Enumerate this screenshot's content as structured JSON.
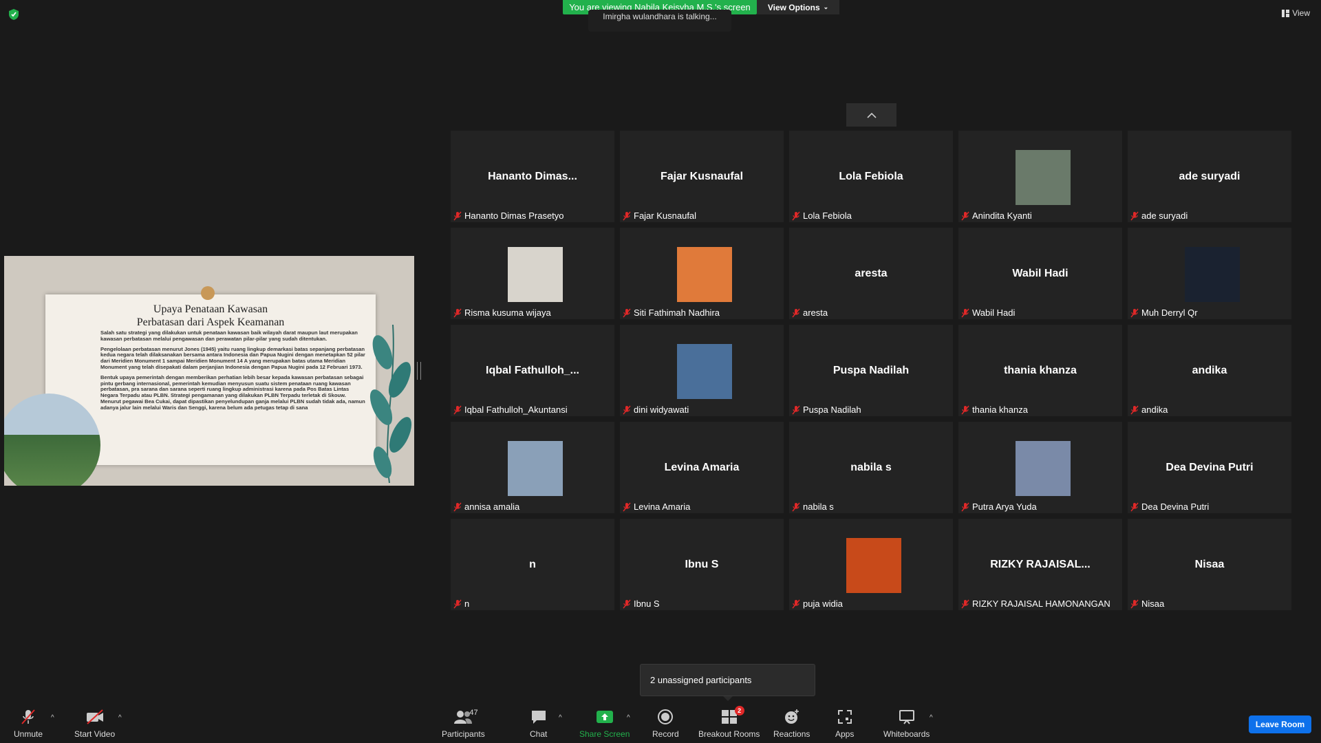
{
  "top": {
    "banner": "You are viewing Nabila Keisyha M.S.'s screen",
    "view_options": "View Options",
    "talking": "Imirgha wulandhara is talking...",
    "view": "View"
  },
  "slide": {
    "title_line1": "Upaya Penataan Kawasan",
    "title_line2": "Perbatasan dari Aspek Keamanan",
    "para1": "Salah satu strategi yang dilakukan untuk penataan kawasan baik wilayah darat maupun laut merupakan kawasan perbatasan melalui pengawasan dan perawatan pilar-pilar yang sudah ditentukan.",
    "para2": "Pengelolaan perbatasan menurut Jones (1945) yaitu ruang lingkup demarkasi batas sepanjang perbatasan kedua negara telah dilaksanakan bersama antara Indonesia dan Papua Nugini dengan menetapkan 52 pilar dari Meridien Monument 1 sampai Meridien Monument 14 A yang merupakan batas utama Meridian Monument yang telah disepakati dalam perjanjian Indonesia dengan Papua Nugini pada 12 Februari 1973.",
    "para3": "Bentuk upaya pemerintah dengan memberikan perhatian lebih besar kepada kawasan perbatasan sebagai pintu gerbang internasional, pemerintah kemudian menyusun suatu sistem penataan ruang kawasan perbatasan, pra sarana dan sarana seperti ruang lingkup administrasi karena pada Pos Batas Lintas Negara Terpadu atau PLBN. Strategi pengamanan yang dilakukan PLBN Terpadu terletak di Skouw. Menurut pegawai Bea Cukai, dapat dipastikan penyelundupan ganja melalui PLBN sudah tidak ada, namun adanya jalur lain melalui Waris dan Senggi, karena belum ada petugas tetap di sana"
  },
  "participants": [
    {
      "big": "Hananto  Dimas...",
      "name": "Hananto Dimas Prasetyo"
    },
    {
      "big": "Fajar Kusnaufal",
      "name": "Fajar Kusnaufal"
    },
    {
      "big": "Lola Febiola",
      "name": "Lola Febiola"
    },
    {
      "big": "",
      "name": "Anindita Kyanti",
      "photo": "#6a7a6a"
    },
    {
      "big": "ade suryadi",
      "name": "ade suryadi"
    },
    {
      "big": "",
      "name": "Risma kusuma wijaya",
      "photo": "#d8d4cc"
    },
    {
      "big": "",
      "name": "Siti Fathimah Nadhira",
      "photo": "#e07a3a"
    },
    {
      "big": "aresta",
      "name": "aresta"
    },
    {
      "big": "Wabil Hadi",
      "name": "Wabil Hadi"
    },
    {
      "big": "",
      "name": "Muh Derryl Qr",
      "photo": "#1a2230"
    },
    {
      "big": "Iqbal  Fathulloh_...",
      "name": "Iqbal Fathulloh_Akuntansi"
    },
    {
      "big": "",
      "name": "dini widyawati",
      "photo": "#4a6f9a"
    },
    {
      "big": "Puspa Nadilah",
      "name": "Puspa Nadilah"
    },
    {
      "big": "thania khanza",
      "name": "thania khanza"
    },
    {
      "big": "andika",
      "name": "andika"
    },
    {
      "big": "",
      "name": "annisa amalia",
      "photo": "#8aa0b8"
    },
    {
      "big": "Levina Amaria",
      "name": "Levina Amaria"
    },
    {
      "big": "nabila s",
      "name": " nabila s"
    },
    {
      "big": "",
      "name": "Putra Arya Yuda",
      "photo": "#7a8aa8"
    },
    {
      "big": "Dea Devina Putri",
      "name": "Dea Devina Putri"
    },
    {
      "big": "n",
      "name": "n"
    },
    {
      "big": "Ibnu S",
      "name": "Ibnu S"
    },
    {
      "big": "",
      "name": "puja widia",
      "photo": "#c84a1a"
    },
    {
      "big": "RIZKY  RAJAISAL...",
      "name": "RIZKY RAJAISAL HAMONANGAN"
    },
    {
      "big": "Nisaa",
      "name": "Nisaa"
    }
  ],
  "popup": {
    "unassigned": "2 unassigned participants"
  },
  "toolbar": {
    "unmute": "Unmute",
    "start_video": "Start Video",
    "participants": "Participants",
    "participants_count": "47",
    "chat": "Chat",
    "share_screen": "Share Screen",
    "record": "Record",
    "breakout_rooms": "Breakout Rooms",
    "breakout_badge": "2",
    "reactions": "Reactions",
    "apps": "Apps",
    "whiteboards": "Whiteboards",
    "leave": "Leave Room"
  },
  "colors": {
    "banner": "#22b14c",
    "share_label": "#22b14c",
    "leave": "#0e71eb",
    "muted": "#e02828"
  }
}
